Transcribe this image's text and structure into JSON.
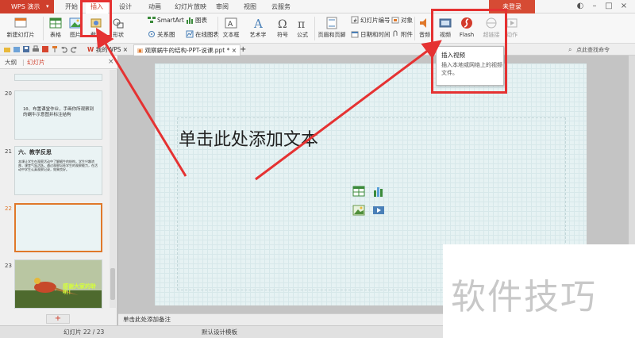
{
  "app": {
    "name": "WPS 演示",
    "login": "未登录"
  },
  "menu": {
    "tabs": [
      "开始",
      "插入",
      "设计",
      "动画",
      "幻灯片放映",
      "审阅",
      "视图",
      "云服务"
    ],
    "active": "插入"
  },
  "ribbon": {
    "new_slide": "新建幻灯片",
    "table": "表格",
    "picture": "图片",
    "screenshot": "截屏",
    "shape": "形状",
    "smartart": "SmartArt",
    "chart": "图表",
    "relation": "关系图",
    "online_chart": "在线图表",
    "textbox": "文本框",
    "wordart": "艺术字",
    "symbol": "符号",
    "formula": "公式",
    "header_footer": "页眉和页脚",
    "slide_number": "幻灯片编号",
    "object": "对象",
    "date_time": "日期和时间",
    "attachment": "附件",
    "audio": "音频",
    "video": "视频",
    "flash": "Flash",
    "hyperlink": "超链接",
    "action": "动作"
  },
  "doc_tabs": {
    "mine": "我的WPS",
    "active": "观察蜗牛的结构-PPT-说课.ppt *",
    "add": "+"
  },
  "help_text": "点此查找命令",
  "left_panel": {
    "tabs": [
      "大纲",
      "幻灯片"
    ],
    "active_tab": "幻灯片",
    "slides": [
      {
        "num": "20",
        "text": "10、布置课堂作业，手画你所观察到的蜗牛示意图并标注结构"
      },
      {
        "num": "21",
        "title": "六、教学反思",
        "text": "本课让学生在观察活动中了解蜗牛的结构，学生兴趣浓厚，课堂气氛活跃。通过观察培养学生的观察能力，在活动中学生认真观察记录，效果良好。"
      },
      {
        "num": "22",
        "text": ""
      },
      {
        "num": "23",
        "caption": "感谢大家的聆听！"
      }
    ]
  },
  "slide": {
    "title_placeholder": "单击此处添加文本"
  },
  "notes": {
    "placeholder": "单击此处添加备注"
  },
  "status": {
    "slide_info": "幻灯片 22 / 23",
    "template": "默认设计模板"
  },
  "tooltip": {
    "title": "插入视频",
    "desc": "插入本地或网络上的视频文件。"
  },
  "watermark": "软件技巧",
  "colors": {
    "accent": "#cf3f2c",
    "annotation": "#e53232"
  }
}
